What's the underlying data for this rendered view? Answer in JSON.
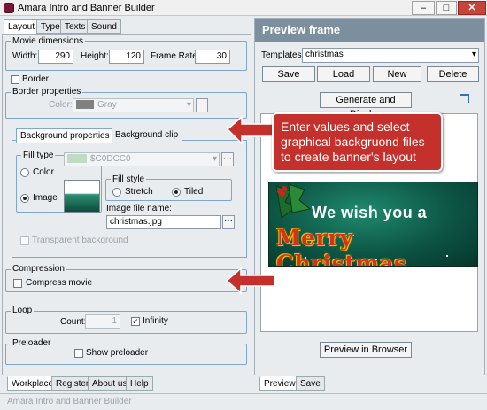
{
  "window": {
    "title": "Amara Intro and Banner Builder",
    "status_text": "Amara Intro and Banner Builder",
    "minimize": "–",
    "maximize": "□",
    "close": "✕"
  },
  "left_tabs": [
    "Layout",
    "Type",
    "Texts",
    "Sound"
  ],
  "movie_dimensions": {
    "label": "Movie dimensions",
    "width_label": "Width:",
    "width_value": "290",
    "height_label": "Height:",
    "height_value": "120",
    "framerate_label": "Frame Rate:",
    "framerate_value": "30"
  },
  "border": {
    "checkbox_label": "Border",
    "properties_label": "Border properties",
    "color_label": "Color:",
    "color_value": "Gray",
    "swatch_color": "#808080"
  },
  "background_tabs": [
    "Background properties",
    "Background clip"
  ],
  "fill_type": {
    "label": "Fill type",
    "color_option": "Color",
    "image_option": "Image",
    "color_value": "$C0DCC0",
    "swatch_color": "#c0dcc0"
  },
  "fill_style": {
    "label": "Fill style",
    "stretch_option": "Stretch",
    "tiled_option": "Tiled"
  },
  "image_file": {
    "label": "Image file name:",
    "value": "christmas.jpg"
  },
  "transparent_bg_label": "Transparent background",
  "compression": {
    "label": "Compression",
    "compress_label": "Compress movie"
  },
  "loop": {
    "label": "Loop",
    "count_label": "Count:",
    "count_value": "1",
    "infinity_label": "Infinity"
  },
  "preloader": {
    "label": "Preloader",
    "show_label": "Show preloader"
  },
  "bottom_tabs": [
    "Workplace",
    "Register",
    "About us",
    "Help"
  ],
  "preview": {
    "header": "Preview frame",
    "templates_label": "Templates:",
    "templates_value": "christmas",
    "save_label": "Save",
    "load_label": "Load",
    "new_label": "New",
    "delete_label": "Delete",
    "generate_label": "Generate and Display",
    "banner_line1": "We wish you a",
    "banner_line2": "Merry Christmas",
    "browser_label": "Preview in Browser",
    "tabs": [
      "Preview",
      "Save"
    ]
  },
  "callout_text": "Enter values and select graphical backgruond files to create banner's layout"
}
